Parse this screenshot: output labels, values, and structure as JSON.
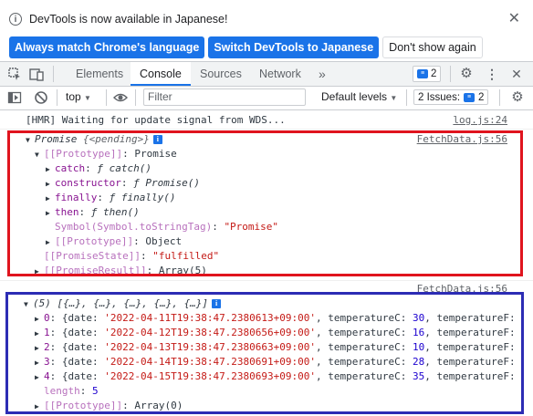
{
  "infobar": {
    "message": "DevTools is now available in Japanese!",
    "btn_match": "Always match Chrome's language",
    "btn_switch": "Switch DevTools to Japanese",
    "btn_dont_show": "Don't show again"
  },
  "tabs": {
    "elements": "Elements",
    "console": "Console",
    "sources": "Sources",
    "network": "Network",
    "more": "»",
    "messages_count": "2"
  },
  "console_toolbar": {
    "context": "top",
    "filter_placeholder": "Filter",
    "levels": "Default levels",
    "issues_label": "2 Issues:",
    "issues_count": "2"
  },
  "console": {
    "hmr": {
      "text": "[HMR] Waiting for update signal from WDS...",
      "source": "log.js:24"
    },
    "promise": {
      "source": "FetchData.js:56",
      "header_name": "Promise",
      "header_state": "{<pending>}",
      "proto_key": "[[Prototype]]",
      "proto_val": "Promise",
      "catch_key": "catch",
      "catch_val": "ƒ catch()",
      "constructor_key": "constructor",
      "constructor_val": "ƒ Promise()",
      "finally_key": "finally",
      "finally_val": "ƒ finally()",
      "then_key": "then",
      "then_val": "ƒ then()",
      "symbol_key": "Symbol(Symbol.toStringTag)",
      "symbol_val": "\"Promise\"",
      "proto2_key": "[[Prototype]]",
      "proto2_val": "Object",
      "state_key": "[[PromiseState]]",
      "state_val": "\"fulfilled\"",
      "result_key": "[[PromiseResult]]",
      "result_val": "Array(5)"
    },
    "array": {
      "source": "FetchData.js:56",
      "header": "(5) [{…}, {…}, {…}, {…}, {…}]",
      "items": [
        {
          "index": "0",
          "date": "'2022-04-11T19:38:47.2380613+09:00'",
          "temp_c": "30",
          "more": "temperatureF:"
        },
        {
          "index": "1",
          "date": "'2022-04-12T19:38:47.2380656+09:00'",
          "temp_c": "16",
          "more": "temperatureF:"
        },
        {
          "index": "2",
          "date": "'2022-04-13T19:38:47.2380663+09:00'",
          "temp_c": "10",
          "more": "temperatureF:"
        },
        {
          "index": "3",
          "date": "'2022-04-14T19:38:47.2380691+09:00'",
          "temp_c": "28",
          "more": "temperatureF:"
        },
        {
          "index": "4",
          "date": "'2022-04-15T19:38:47.2380693+09:00'",
          "temp_c": "35",
          "more": "temperatureF:"
        }
      ],
      "length_key": "length",
      "length_val": "5",
      "proto_key": "[[Prototype]]",
      "proto_val": "Array(0)"
    }
  },
  "colors": {
    "accent": "#1a73e8",
    "highlight_red": "#e0141e",
    "highlight_blue": "#2c2cb4"
  }
}
